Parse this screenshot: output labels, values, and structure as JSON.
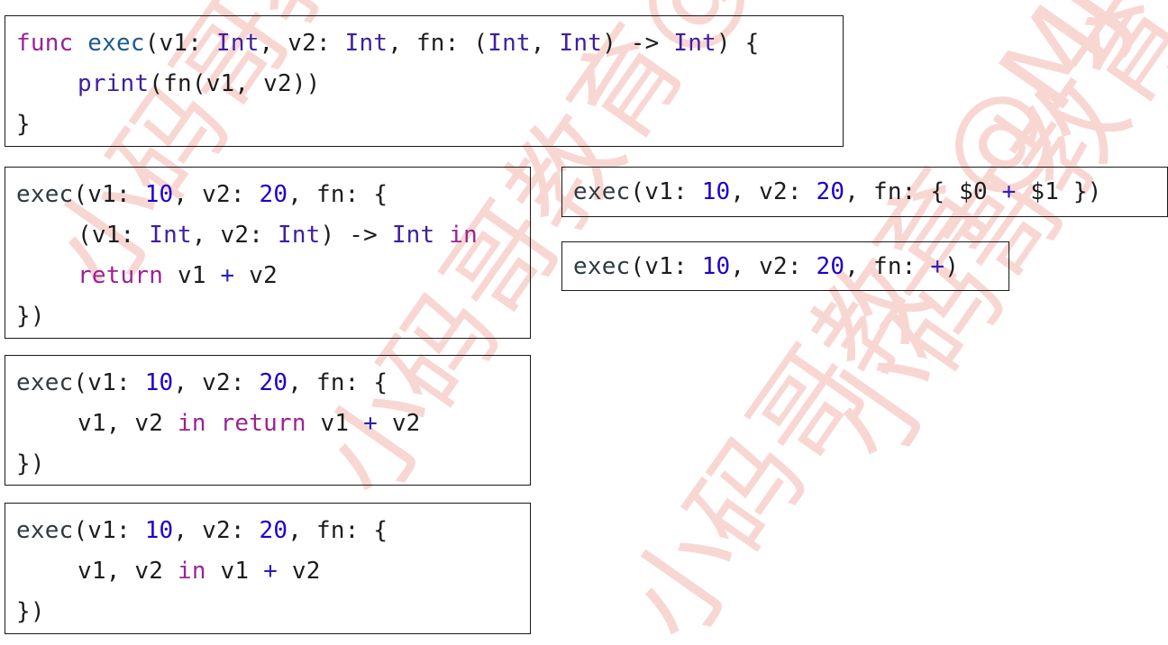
{
  "watermark": {
    "text": "小码哥教育@MJ",
    "color": "#f3b7b0"
  },
  "colors": {
    "keyword": "#9b2393",
    "type": "#3f1fa1",
    "function_name": "#1a5a96",
    "number": "#1c00cf",
    "plain": "#1c1c1c"
  },
  "blocks": {
    "definition": {
      "l1": {
        "func_kw": "func",
        "name": "exec",
        "p_open": "(v1: ",
        "t1": "Int",
        "p_v2": ", v2: ",
        "t2": "Int",
        "p_fn": ", fn: (",
        "t3": "Int",
        "p_comma": ", ",
        "t4": "Int",
        "p_arrow": ") -> ",
        "t5": "Int",
        "p_close": ") {"
      },
      "l2": {
        "print": "print",
        "rest": "(fn(v1, v2))"
      },
      "l3": "}"
    },
    "full_closure": {
      "l1": {
        "call": "exec",
        "a": "(v1: ",
        "n1": "10",
        "b": ", v2: ",
        "n2": "20",
        "c": ", fn: {"
      },
      "l2": {
        "a": "(v1: ",
        "t1": "Int",
        "b": ", v2: ",
        "t2": "Int",
        "c": ") -> ",
        "t3": "Int",
        "d": " ",
        "in_kw": "in"
      },
      "l3": {
        "return_kw": "return",
        "a": " v1 ",
        "op": "+",
        "b": " v2"
      },
      "l4": "})"
    },
    "inferred_closure": {
      "l1": {
        "call": "exec",
        "a": "(v1: ",
        "n1": "10",
        "b": ", v2: ",
        "n2": "20",
        "c": ", fn: {"
      },
      "l2": {
        "a": "v1, v2 ",
        "in_kw": "in",
        "b": " ",
        "return_kw": "return",
        "c": " v1 ",
        "op": "+",
        "d": " v2"
      },
      "l3": "})"
    },
    "implicit_return": {
      "l1": {
        "call": "exec",
        "a": "(v1: ",
        "n1": "10",
        "b": ", v2: ",
        "n2": "20",
        "c": ", fn: {"
      },
      "l2": {
        "a": "v1, v2 ",
        "in_kw": "in",
        "b": " v1 ",
        "op": "+",
        "c": " v2"
      },
      "l3": "})"
    },
    "shorthand_args": {
      "call": "exec",
      "a": "(v1: ",
      "n1": "10",
      "b": ", v2: ",
      "n2": "20",
      "c": ", fn: { $0 ",
      "op": "+",
      "d": " $1 })"
    },
    "operator_fn": {
      "call": "exec",
      "a": "(v1: ",
      "n1": "10",
      "b": ", v2: ",
      "n2": "20",
      "c": ", fn: ",
      "op": "+",
      "d": ")"
    }
  }
}
